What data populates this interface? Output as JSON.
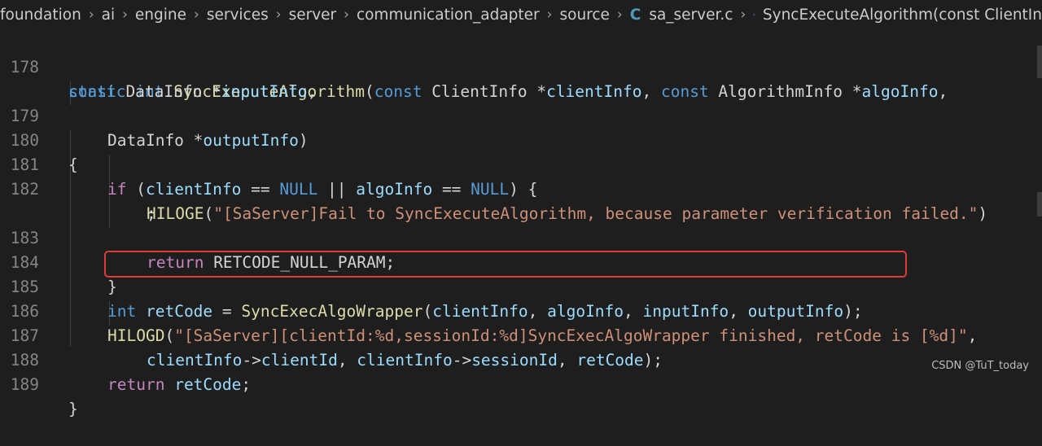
{
  "breadcrumb": {
    "items": [
      "foundation",
      "ai",
      "engine",
      "services",
      "server",
      "communication_adapter",
      "source"
    ],
    "file_icon": "C",
    "file": "sa_server.c",
    "symbol_icon": "cube-icon",
    "symbol": "SyncExecuteAlgorithm(const ClientIn"
  },
  "lines": [
    {
      "num": "178",
      "wrap": false
    },
    {
      "num": "",
      "wrap": true
    },
    {
      "num": "179"
    },
    {
      "num": "180"
    },
    {
      "num": "181"
    },
    {
      "num": "182"
    },
    {
      "num": ""
    },
    {
      "num": "183"
    },
    {
      "num": "184"
    },
    {
      "num": "185"
    },
    {
      "num": "186"
    },
    {
      "num": "187"
    },
    {
      "num": "188"
    },
    {
      "num": "189"
    }
  ],
  "tokens": {
    "l178": [
      "static",
      " ",
      "int",
      " ",
      "SyncExecuteAlgorithm",
      "(",
      "const",
      " ClientInfo *",
      "clientInfo",
      ", ",
      "const",
      " AlgorithmInfo *",
      "algoInfo",
      ","
    ],
    "l178b": [
      "const",
      " DataInfo *",
      "inputInfo",
      ","
    ],
    "l179": [
      "DataInfo *",
      "outputInfo",
      ")"
    ],
    "l180": [
      "{"
    ],
    "l181": [
      "if",
      " (",
      "clientInfo",
      " == ",
      "NULL",
      " || ",
      "algoInfo",
      " == ",
      "NULL",
      ") {"
    ],
    "l182": [
      "HILOGE",
      "(",
      "\"[SaServer]Fail to SyncExecuteAlgorithm, because parameter verification failed.\"",
      ")"
    ],
    "l182b": [
      ";"
    ],
    "l183": [
      "return",
      " RETCODE_NULL_PARAM;"
    ],
    "l184": [
      "}"
    ],
    "l185": [
      "int",
      " ",
      "retCode",
      " = ",
      "SyncExecAlgoWrapper",
      "(",
      "clientInfo",
      ", ",
      "algoInfo",
      ", ",
      "inputInfo",
      ", ",
      "outputInfo",
      ");"
    ],
    "l186": [
      "HILOGD",
      "(",
      "\"[SaServer][clientId:%d,sessionId:%d]SyncExecAlgoWrapper finished, retCode is [%d]\"",
      ","
    ],
    "l187": [
      "clientInfo",
      "->",
      "clientId",
      ", ",
      "clientInfo",
      "->",
      "sessionId",
      ", ",
      "retCode",
      ");"
    ],
    "l188": [
      "return",
      " ",
      "retCode",
      ";"
    ],
    "l189": [
      "}"
    ]
  },
  "watermark": "CSDN @TuT_today",
  "colors": {
    "keyword": "#569cd6",
    "control": "#c586c0",
    "function": "#dcdcaa",
    "variable": "#9cdcfe",
    "string": "#ce9178",
    "highlight_box": "#e03a3a"
  }
}
